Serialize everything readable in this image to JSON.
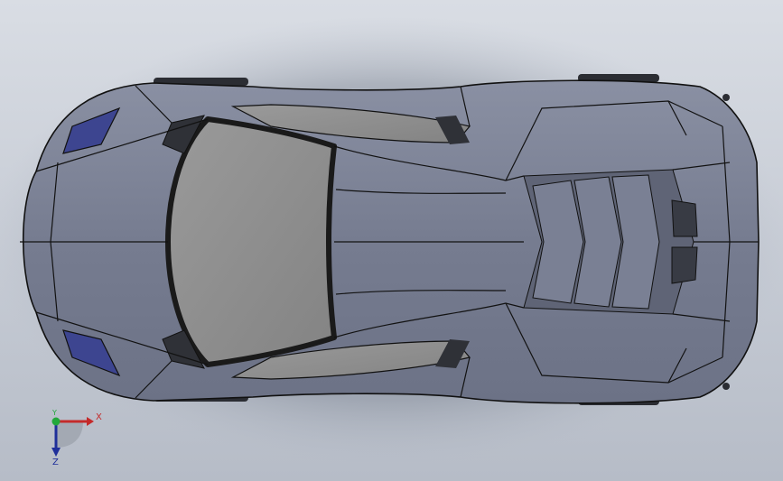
{
  "viewport": {
    "background_top": "#d9dde4",
    "background_bottom": "#b6bcc7"
  },
  "model": {
    "body_color": "#7a8094",
    "glass_color": "#8e8e8e",
    "headlight_color": "#3d4590",
    "edge_color": "#111111"
  },
  "triad": {
    "x_label": "X",
    "y_label": "Y",
    "z_label": "Z",
    "x_color": "#c42a2a",
    "y_color": "#22a83a",
    "z_color": "#1f2f9a"
  }
}
